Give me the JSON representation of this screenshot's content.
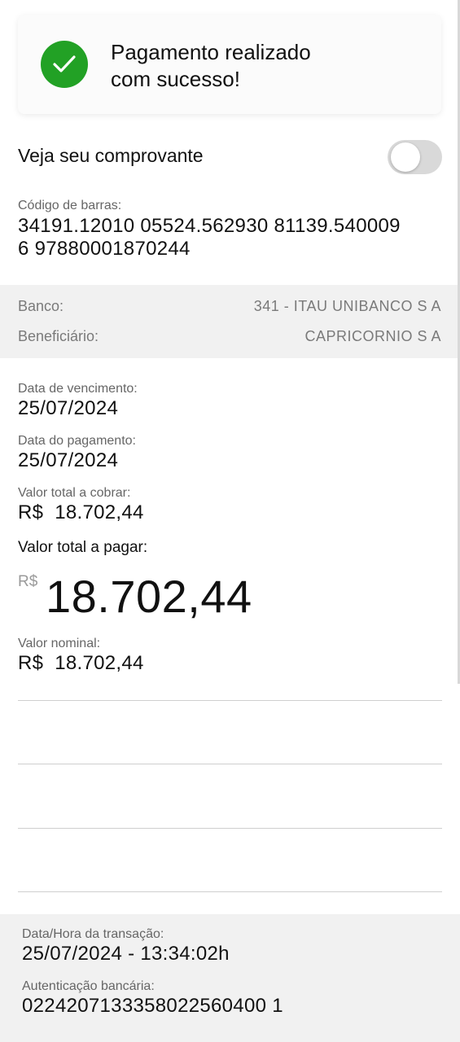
{
  "success": {
    "title_line1": "Pagamento realizado",
    "title_line2": "com sucesso!",
    "icon": "check-icon",
    "color": "#22a125"
  },
  "receipt": {
    "label": "Veja seu comprovante",
    "toggle_on": false
  },
  "barcode": {
    "label": "Código de barras:",
    "line1": "34191.12010 05524.562930 81139.540009",
    "line2": "6 97880001870244"
  },
  "bank": {
    "bank_label": "Banco:",
    "bank_value": "341 - ITAU UNIBANCO S A",
    "beneficiary_label": "Beneficiário:",
    "beneficiary_value": "CAPRICORNIO S A"
  },
  "details": {
    "due_date_label": "Data de vencimento:",
    "due_date": "25/07/2024",
    "payment_date_label": "Data do pagamento:",
    "payment_date": "25/07/2024",
    "total_charge_label": "Valor total a cobrar:",
    "total_charge": "R$  18.702,44",
    "total_pay_label": "Valor total a pagar:",
    "total_pay_currency": "R$",
    "total_pay_amount": "18.702,44",
    "nominal_label": "Valor nominal:",
    "nominal_value": "R$  18.702,44"
  },
  "footer": {
    "datetime_label": "Data/Hora da transação:",
    "datetime_value": "25/07/2024 - 13:34:02h",
    "auth_label": "Autenticação bancária:",
    "auth_value": "0224207133358022560400 1"
  }
}
